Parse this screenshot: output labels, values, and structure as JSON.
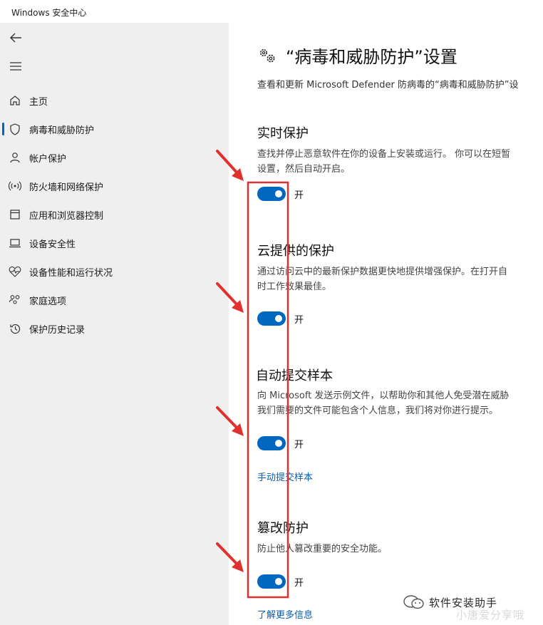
{
  "window": {
    "title": "Windows 安全中心"
  },
  "sidebar": {
    "items": [
      {
        "label": "主页",
        "icon": "home-icon"
      },
      {
        "label": "病毒和威胁防护",
        "icon": "shield-icon",
        "selected": true
      },
      {
        "label": "帐户保护",
        "icon": "person-icon"
      },
      {
        "label": "防火墙和网络保护",
        "icon": "wifi-antenna-icon"
      },
      {
        "label": "应用和浏览器控制",
        "icon": "app-window-icon"
      },
      {
        "label": "设备安全性",
        "icon": "laptop-icon"
      },
      {
        "label": "设备性能和运行状况",
        "icon": "heart-pulse-icon"
      },
      {
        "label": "家庭选项",
        "icon": "family-icon"
      },
      {
        "label": "保护历史记录",
        "icon": "history-icon"
      }
    ]
  },
  "main": {
    "title": "“病毒和威胁防护”设置",
    "description": "查看和更新 Microsoft Defender 防病毒的“病毒和威胁防护”设",
    "sections": [
      {
        "title": "实时保护",
        "desc_lines": [
          "查找并停止恶意软件在你的设备上安装或运行。 你可以在短暂",
          "设置，然后自动开启。"
        ],
        "toggle_label": "开"
      },
      {
        "title": "云提供的保护",
        "desc_lines": [
          "通过访问云中的最新保护数据更快地提供增强保护。在打开自",
          "时工作效果最佳。"
        ],
        "toggle_label": "开"
      },
      {
        "title": "自动提交样本",
        "desc_lines": [
          "向 Microsoft 发送示例文件，以帮助你和其他人免受潜在威胁",
          "我们需要的文件可能包含个人信息，我们将对你进行提示。"
        ],
        "toggle_label": "开",
        "link": "手动提交样本"
      },
      {
        "title": "篡改防护",
        "desc_lines": [
          "防止他人篡改重要的安全功能。"
        ],
        "toggle_label": "开",
        "link": "了解更多信息"
      }
    ]
  },
  "watermark": {
    "line1": "软件安装助手",
    "line2": "小唐爱分享哦"
  },
  "colors": {
    "accent": "#0067c0",
    "link": "#005fb8",
    "annotation": "#e0312f",
    "sidebar_bg": "#efefef"
  }
}
